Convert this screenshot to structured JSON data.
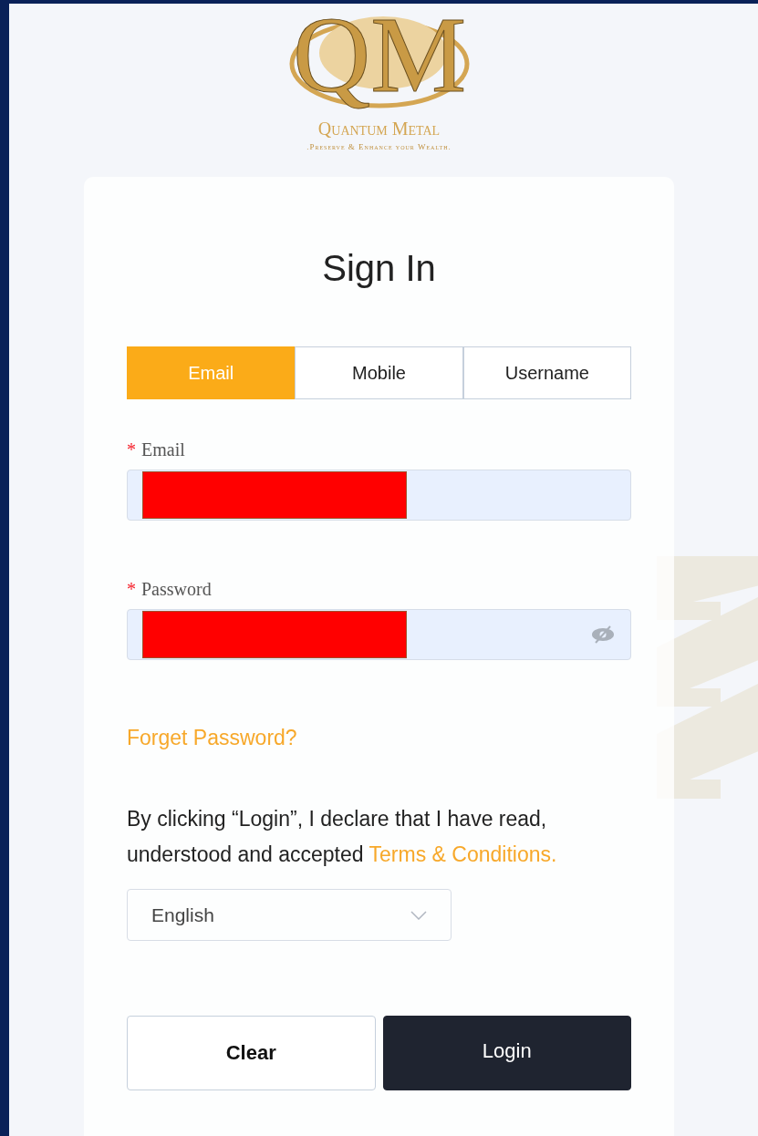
{
  "logo": {
    "monogram": "QM",
    "name": "Quantum Metal",
    "tagline": ".Preserve & Enhance your Wealth."
  },
  "card": {
    "title": "Sign In",
    "tabs": [
      {
        "label": "Email",
        "selected": true
      },
      {
        "label": "Mobile",
        "selected": false
      },
      {
        "label": "Username",
        "selected": false
      }
    ],
    "fields": [
      {
        "kind": "text",
        "label": "Email",
        "marker": "*",
        "redacted": true
      },
      {
        "kind": "password",
        "label": "Password",
        "marker": "*",
        "redacted": true
      }
    ],
    "forgot_link": "Forget Password?",
    "consent": {
      "text": "By clicking “Login”, I declare that I have read, understood and accepted ",
      "link": "Terms & Conditions."
    },
    "language": {
      "value": "English"
    },
    "buttons": [
      {
        "kind": "secondary",
        "label": "Clear"
      },
      {
        "kind": "primary",
        "label": "Login"
      }
    ]
  }
}
